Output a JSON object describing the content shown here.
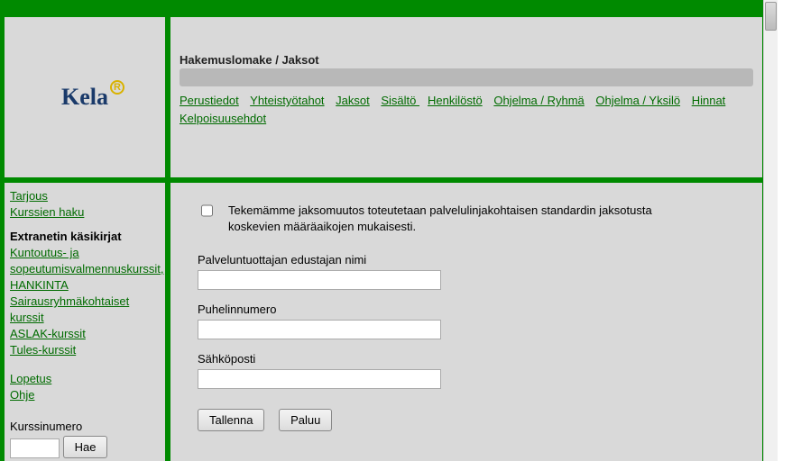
{
  "logo": {
    "text": "Kela",
    "badge": "R"
  },
  "header": {
    "title": "Hakemuslomake / Jaksot",
    "tabs": [
      "Perustiedot",
      "Yhteistyötahot",
      "Jaksot",
      "Sisältö ",
      "Henkilöstö",
      "Ohjelma / Ryhmä",
      "Ohjelma / Yksilö",
      "Hinnat",
      "Kelpoisuusehdot"
    ]
  },
  "sidebar": {
    "top": [
      "Tarjous",
      "Kurssien haku"
    ],
    "section1_title": "Extranetin käsikirjat",
    "section1": [
      "Kuntoutus- ja sopeutumisvalmennuskurssit, HANKINTA",
      "Sairausryhmäkohtaiset kurssit",
      "ASLAK-kurssit",
      "Tules-kurssit"
    ],
    "bottom": [
      "Lopetus",
      "Ohje"
    ],
    "search_label": "Kurssinumero",
    "search_value": "",
    "search_button": "Hae"
  },
  "main": {
    "checkbox_checked": false,
    "checkbox_text": "Tekemämme jaksomuutos toteutetaan palvelulinjakohtaisen standardin jaksotusta koskevien määräaikojen mukaisesti.",
    "fields": [
      {
        "label": "Palveluntuottajan edustajan nimi",
        "value": ""
      },
      {
        "label": "Puhelinnumero",
        "value": ""
      },
      {
        "label": "Sähköposti",
        "value": ""
      }
    ],
    "save_label": "Tallenna",
    "back_label": "Paluu"
  }
}
